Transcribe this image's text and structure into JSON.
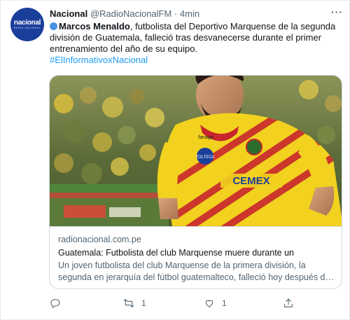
{
  "account": {
    "avatar_text": "nacional",
    "avatar_subtext": "RADIO NACIONAL",
    "display_name": "Nacional",
    "handle": "@RadioNacionalFM",
    "separator": "·",
    "time": "4min"
  },
  "menu": {
    "more_label": "···"
  },
  "tweet": {
    "mention": "Marcos Menaldo",
    "text_part1": ", futbolista del Deportivo Marquense de la segunda división de Guatemala, falleció tras desvanecerse durante el primer entrenamiento del año de su equipo.",
    "hashtag": "#ElInformativoxNacional"
  },
  "card": {
    "image_description_icon": "news-photo",
    "shirt_texts": [
      "TOLTECA",
      "CEMEX",
      "fanaga"
    ],
    "domain": "radionacional.com.pe",
    "title": "Guatemala: Futbolista del club Marquense muere durante un",
    "description_line1": "Un joven futbolista del club Marquense de la primera división, la",
    "description_line2": "segunda en jerarquía del fútbol guatemalteco, falleció hoy después de..."
  },
  "actions": {
    "reply_icon": "reply-icon",
    "reply_count": "",
    "retweet_icon": "retweet-icon",
    "retweet_count": "1",
    "like_icon": "like-icon",
    "like_count": "1",
    "share_icon": "share-icon"
  },
  "colors": {
    "accent": "#1d9bf0",
    "avatar_bg": "#1a3f9a",
    "jersey_yellow": "#f2d21e",
    "jersey_red": "#c8262e"
  }
}
